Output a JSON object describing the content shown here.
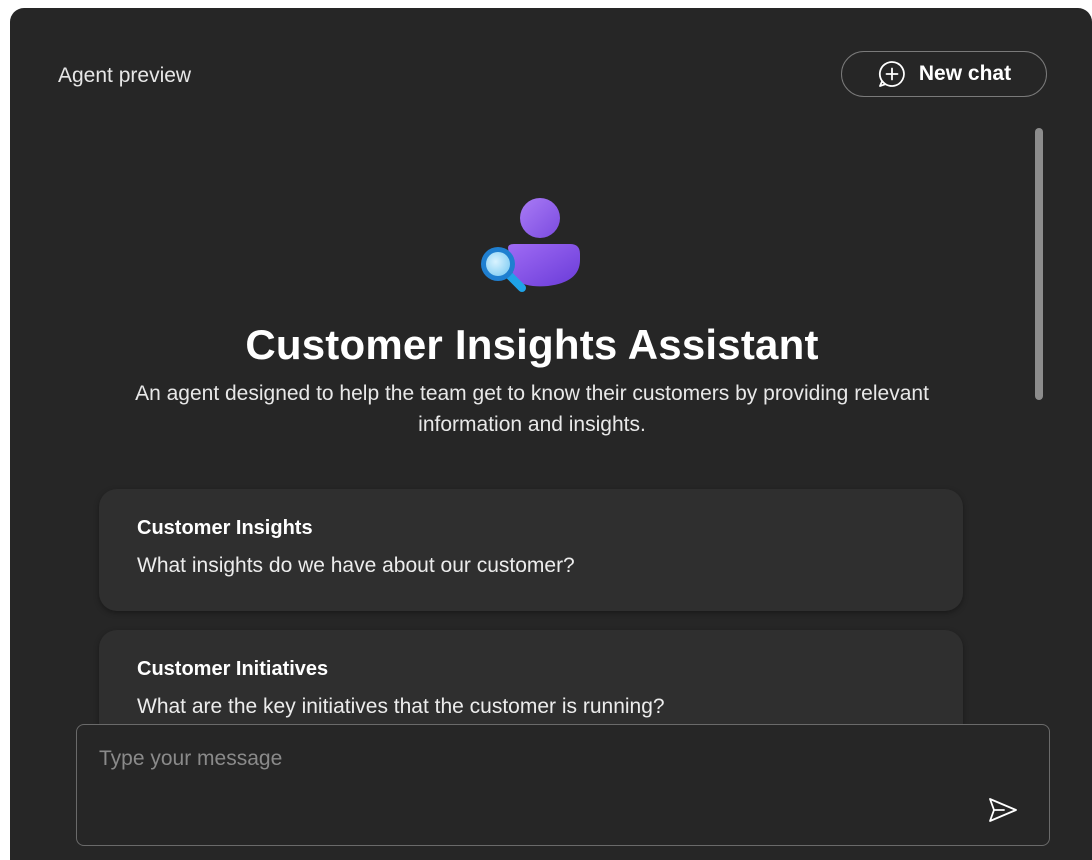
{
  "header": {
    "title": "Agent preview",
    "new_chat_label": "New chat"
  },
  "agent": {
    "icon": "person-search-icon",
    "title": "Customer Insights Assistant",
    "description": "An agent designed to help the team get to know their customers by providing relevant information and insights."
  },
  "suggestions": [
    {
      "title": "Customer Insights",
      "prompt": "What insights do we have about our customer?"
    },
    {
      "title": "Customer Initiatives",
      "prompt": "What are the key initiatives that the customer is running?"
    }
  ],
  "composer": {
    "placeholder": "Type your message",
    "value": "",
    "send_icon": "send-icon"
  },
  "colors": {
    "panel_bg": "#262626",
    "card_bg": "#2f2f2f",
    "accent_purple": "#8b5cf6",
    "accent_blue": "#1fa3e8"
  }
}
